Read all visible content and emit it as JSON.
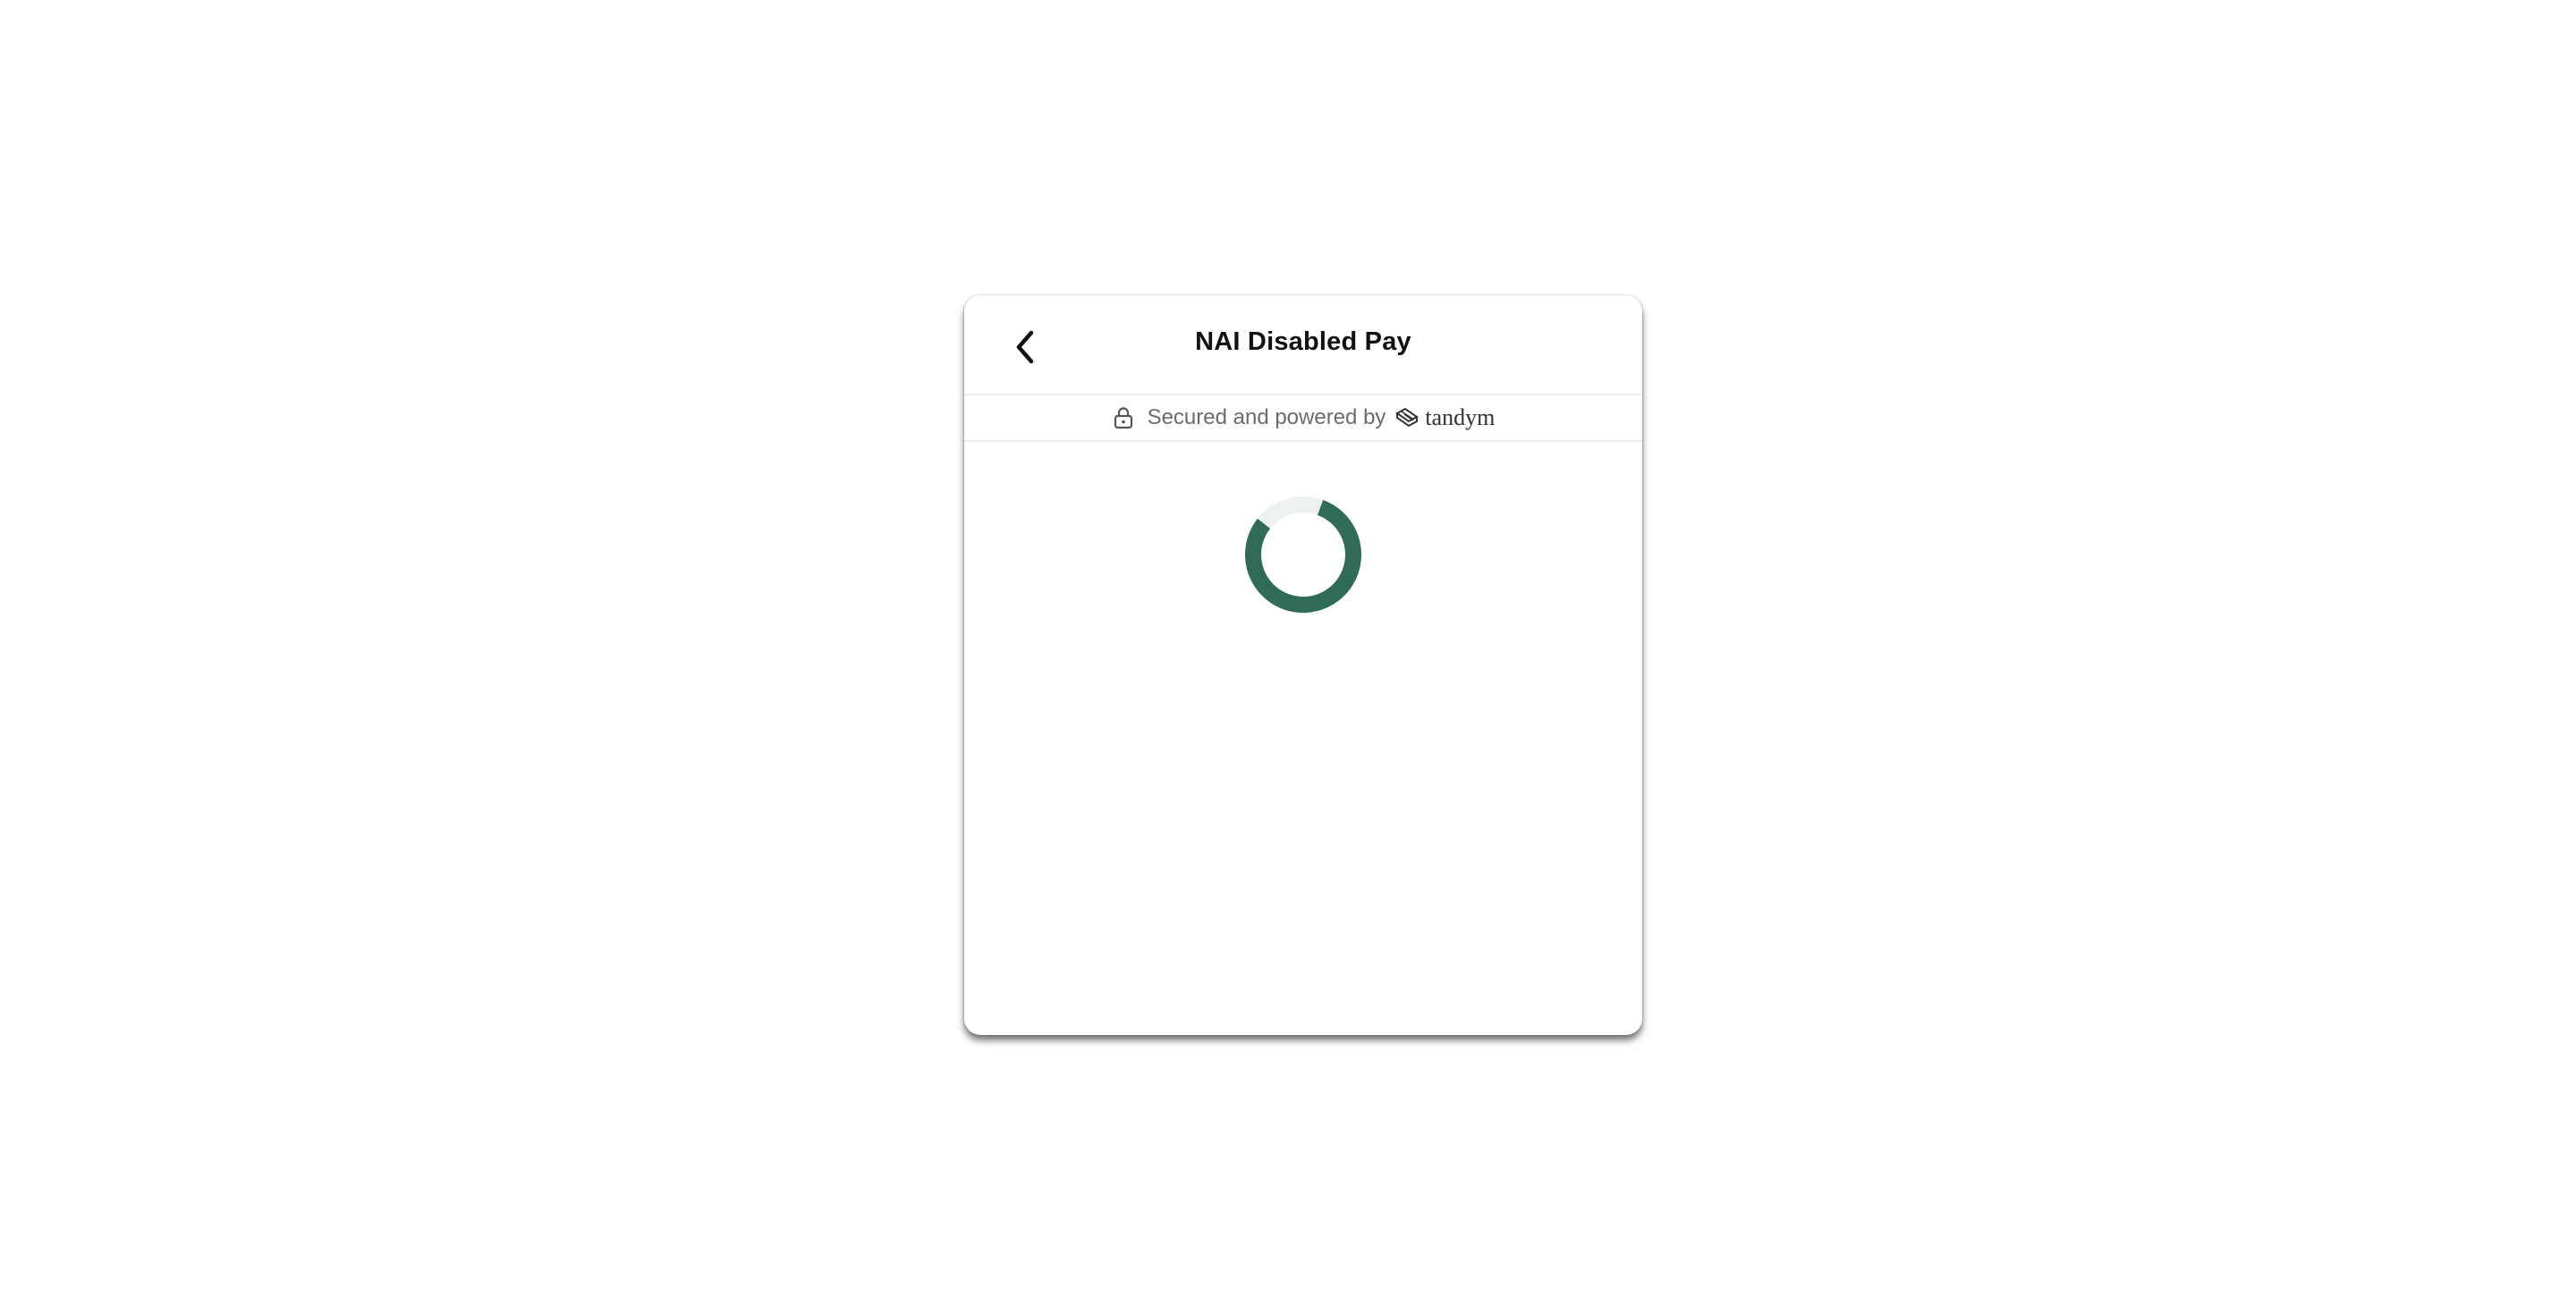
{
  "header": {
    "title": "NAI Disabled Pay"
  },
  "secure_bar": {
    "text": "Secured and powered by",
    "brand_name": "tandym"
  },
  "icons": {
    "back": "chevron-left-icon",
    "lock": "lock-icon",
    "brand": "tandym-logo-icon"
  },
  "spinner": {
    "progress": 0.8
  },
  "colors": {
    "accent": "#2f6b57",
    "spinner_track": "#edf2f0",
    "text_primary": "#111111",
    "text_secondary": "#6b6b6b"
  }
}
